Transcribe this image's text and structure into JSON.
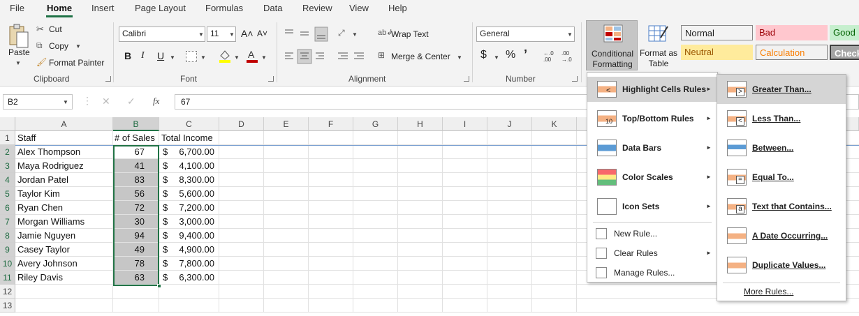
{
  "tabs": [
    "File",
    "Home",
    "Insert",
    "Page Layout",
    "Formulas",
    "Data",
    "Review",
    "View",
    "Help"
  ],
  "clipboard": {
    "paste": "Paste",
    "cut": "Cut",
    "copy": "Copy",
    "format_painter": "Format Painter",
    "label": "Clipboard"
  },
  "font": {
    "name": "Calibri",
    "size": "11",
    "label": "Font",
    "bold": "B",
    "italic": "I",
    "underline": "U",
    "grow": "A˄",
    "shrink": "A˅"
  },
  "alignment": {
    "wrap_text": "Wrap Text",
    "merge_center": "Merge & Center",
    "label": "Alignment"
  },
  "number": {
    "format": "General",
    "dollar": "$",
    "percent": "%",
    "comma": "’",
    "inc_dec": "←.0 .00",
    "dec_dec": ".00 →.0",
    "label": "Number"
  },
  "styles": {
    "conditional_formatting": "Conditional Formatting",
    "format_as_table": "Format as Table",
    "cells": [
      {
        "label": "Normal",
        "bg": "#ffffff",
        "fg": "#000000"
      },
      {
        "label": "Bad",
        "bg": "#ffc7ce",
        "fg": "#9c0006"
      },
      {
        "label": "Good",
        "bg": "#c6efce",
        "fg": "#006100"
      },
      {
        "label": "Neutral",
        "bg": "#ffeb9c",
        "fg": "#9c5700"
      },
      {
        "label": "Calculation",
        "bg": "#f2f2f2",
        "fg": "#fa7d00"
      },
      {
        "label": "Check",
        "bg": "#a5a5a5",
        "fg": "#ffffff"
      }
    ]
  },
  "formula_bar": {
    "name_box": "B2",
    "fx": "fx",
    "value": "67"
  },
  "columns": [
    "A",
    "B",
    "C",
    "D",
    "E",
    "F",
    "G",
    "H",
    "I",
    "J",
    "K"
  ],
  "rows": [
    {
      "n": "1",
      "a": "Staff",
      "b": "# of Sales",
      "c_sym": "",
      "c_val": "Total Income"
    },
    {
      "n": "2",
      "a": "Alex Thompson",
      "b": "67",
      "c_sym": "$",
      "c_val": "6,700.00"
    },
    {
      "n": "3",
      "a": "Maya Rodriguez",
      "b": "41",
      "c_sym": "$",
      "c_val": "4,100.00"
    },
    {
      "n": "4",
      "a": "Jordan Patel",
      "b": "83",
      "c_sym": "$",
      "c_val": "8,300.00"
    },
    {
      "n": "5",
      "a": "Taylor Kim",
      "b": "56",
      "c_sym": "$",
      "c_val": "5,600.00"
    },
    {
      "n": "6",
      "a": "Ryan Chen",
      "b": "72",
      "c_sym": "$",
      "c_val": "7,200.00"
    },
    {
      "n": "7",
      "a": "Morgan Williams",
      "b": "30",
      "c_sym": "$",
      "c_val": "3,000.00"
    },
    {
      "n": "8",
      "a": "Jamie Nguyen",
      "b": "94",
      "c_sym": "$",
      "c_val": "9,400.00"
    },
    {
      "n": "9",
      "a": "Casey Taylor",
      "b": "49",
      "c_sym": "$",
      "c_val": "4,900.00"
    },
    {
      "n": "10",
      "a": "Avery Johnson",
      "b": "78",
      "c_sym": "$",
      "c_val": "7,800.00"
    },
    {
      "n": "11",
      "a": "Riley Davis",
      "b": "63",
      "c_sym": "$",
      "c_val": "6,300.00"
    },
    {
      "n": "12",
      "a": "",
      "b": "",
      "c_sym": "",
      "c_val": ""
    },
    {
      "n": "13",
      "a": "",
      "b": "",
      "c_sym": "",
      "c_val": ""
    }
  ],
  "cf_menu": [
    {
      "label": "Highlight Cells Rules",
      "u": "H",
      "submenu": true
    },
    {
      "label": "Top/Bottom Rules",
      "u": "T",
      "submenu": true
    },
    {
      "label": "Data Bars",
      "u": "D",
      "submenu": true
    },
    {
      "label": "Color Scales",
      "u": "S",
      "submenu": true
    },
    {
      "label": "Icon Sets",
      "u": "I",
      "submenu": true
    },
    {
      "label": "New Rule...",
      "u": "N",
      "submenu": false
    },
    {
      "label": "Clear Rules",
      "u": "C",
      "submenu": true
    },
    {
      "label": "Manage Rules...",
      "u": "R",
      "submenu": false
    }
  ],
  "highlight_menu": [
    {
      "label": "Greater Than..."
    },
    {
      "label": "Less Than..."
    },
    {
      "label": "Between..."
    },
    {
      "label": "Equal To..."
    },
    {
      "label": "Text that Contains..."
    },
    {
      "label": "A Date Occurring..."
    },
    {
      "label": "Duplicate Values..."
    },
    {
      "label": "More Rules..."
    }
  ],
  "colors": {
    "accent": "#217346",
    "selection": "#c6c6c6",
    "menu_hover": "#d5d5d5"
  }
}
